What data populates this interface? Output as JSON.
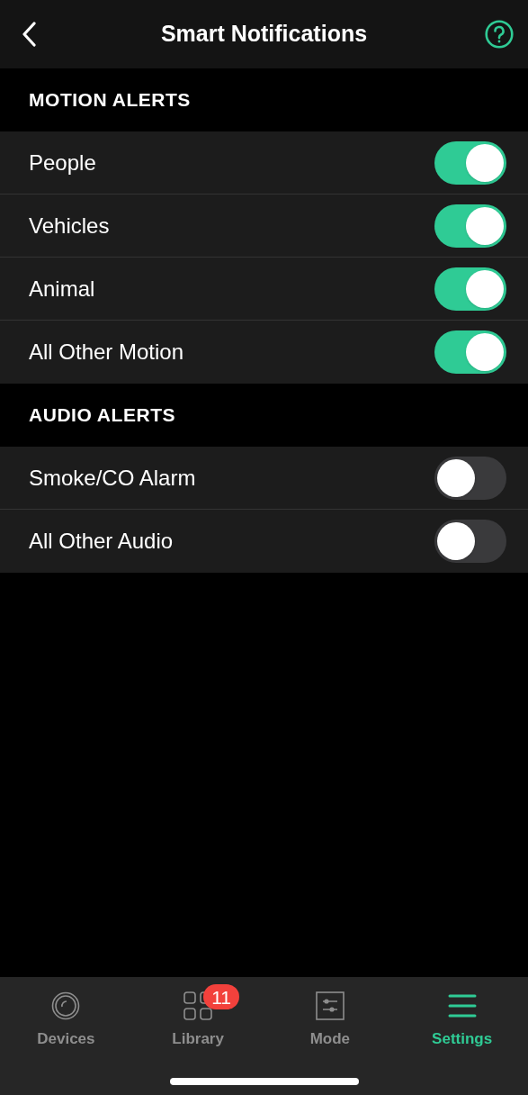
{
  "header": {
    "title": "Smart Notifications"
  },
  "sections": [
    {
      "title": "MOTION ALERTS",
      "items": [
        {
          "label": "People",
          "on": true
        },
        {
          "label": "Vehicles",
          "on": true
        },
        {
          "label": "Animal",
          "on": true
        },
        {
          "label": "All Other Motion",
          "on": true
        }
      ]
    },
    {
      "title": "AUDIO ALERTS",
      "items": [
        {
          "label": "Smoke/CO Alarm",
          "on": false
        },
        {
          "label": "All Other Audio",
          "on": false
        }
      ]
    }
  ],
  "tab_bar": [
    {
      "label": "Devices",
      "kind": "devices",
      "selected": false
    },
    {
      "label": "Library",
      "kind": "library",
      "selected": false,
      "badge": "11"
    },
    {
      "label": "Mode",
      "kind": "mode",
      "selected": false
    },
    {
      "label": "Settings",
      "kind": "settings",
      "selected": true
    }
  ]
}
